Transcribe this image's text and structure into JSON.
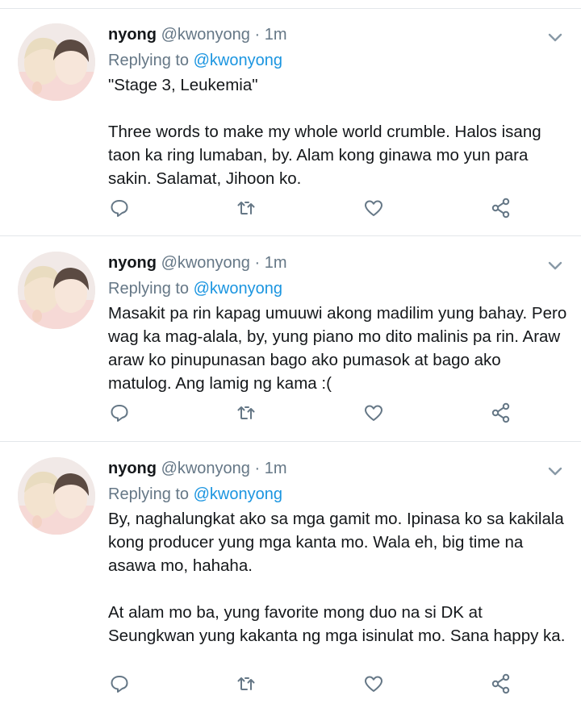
{
  "colors": {
    "name": "#14171a",
    "muted": "#657786",
    "link": "#1b95e0",
    "icon": "#657786",
    "divider": "#e3e6ea"
  },
  "icons": {
    "reply": "speech-bubble",
    "retweet": "retweet-arrows",
    "like": "heart-outline",
    "share": "share-nodes",
    "menu": "chevron-down"
  },
  "tweets": [
    {
      "name": "nyong",
      "handle": "@kwonyong",
      "sep": "·",
      "time": "1m",
      "replying_prefix": "Replying to ",
      "replying_to": "@kwonyong",
      "paragraphs": [
        "\"Stage 3, Leukemia\"",
        "Three words to make my whole world crumble. Halos isang taon ka ring lumaban, by. Alam kong ginawa mo yun para sakin. Salamat, Jihoon ko."
      ]
    },
    {
      "name": "nyong",
      "handle": "@kwonyong",
      "sep": "·",
      "time": "1m",
      "replying_prefix": "Replying to ",
      "replying_to": "@kwonyong",
      "paragraphs": [
        "Masakit pa rin kapag umuuwi akong madilim yung bahay. Pero wag ka mag-alala, by, yung piano mo dito malinis pa rin. Araw araw ko pinupunasan bago ako pumasok at bago ako matulog. Ang lamig ng kama :("
      ]
    },
    {
      "name": "nyong",
      "handle": "@kwonyong",
      "sep": "·",
      "time": "1m",
      "replying_prefix": "Replying to ",
      "replying_to": "@kwonyong",
      "paragraphs": [
        "By, naghalungkat ako sa mga gamit mo. Ipinasa ko sa kakilala kong producer yung mga kanta mo. Wala eh, big time na asawa mo, hahaha.",
        "At alam mo ba, yung favorite mong duo na si DK at Seungkwan yung kakanta ng mga isinulat mo. Sana happy ka."
      ]
    }
  ]
}
